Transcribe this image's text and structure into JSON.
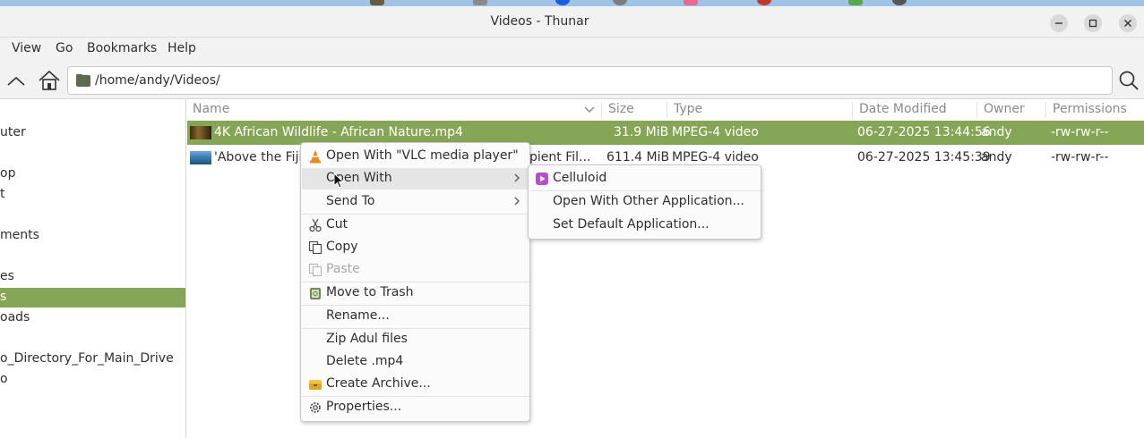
{
  "window": {
    "title": "Videos - Thunar"
  },
  "menubar": {
    "items": [
      "View",
      "Go",
      "Bookmarks",
      "Help"
    ]
  },
  "toolbar": {
    "path": "/home/andy/Videos/"
  },
  "sidebar": {
    "items": [
      {
        "label": "uter",
        "selected": false
      },
      {
        "label": "op",
        "selected": false
      },
      {
        "label": "t",
        "selected": false
      },
      {
        "label": "ments",
        "selected": false
      },
      {
        "label": "es",
        "selected": false
      },
      {
        "label": "s",
        "selected": true
      },
      {
        "label": "oads",
        "selected": false
      },
      {
        "label": "o_Directory_For_Main_Drive",
        "selected": false
      },
      {
        "label": "o",
        "selected": false
      }
    ]
  },
  "columns": {
    "name": "Name",
    "size": "Size",
    "type": "Type",
    "date": "Date Modified",
    "owner": "Owner",
    "permissions": "Permissions"
  },
  "files": [
    {
      "name": "4K African Wildlife - African Nature.mp4",
      "size": "31.9 MiB",
      "type": "MPEG-4 video",
      "date": "06-27-2025 13:44:56",
      "owner": "andy",
      "permissions": "-rw-rw-r--",
      "selected": true
    },
    {
      "name": "'Above the Fiji",
      "name_tail": "pient Fil...",
      "size": "611.4 MiB",
      "type": "MPEG-4 video",
      "date": "06-27-2025 13:45:39",
      "owner": "andy",
      "permissions": "-rw-rw-r--",
      "selected": false
    }
  ],
  "context_menu": {
    "items": [
      {
        "label": "Open With \"VLC media player\"",
        "icon": "vlc-icon"
      },
      {
        "label": "Open With",
        "icon": "",
        "submenu": true,
        "hover": true
      },
      {
        "label": "Send To",
        "icon": "",
        "submenu": true
      },
      {
        "label": "Cut",
        "icon": "scissors-icon"
      },
      {
        "label": "Copy",
        "icon": "copy-icon"
      },
      {
        "label": "Paste",
        "icon": "paste-icon",
        "disabled": true
      },
      {
        "label": "Move to Trash",
        "icon": "trash-icon"
      },
      {
        "label": "Rename...",
        "icon": ""
      },
      {
        "label": "Zip Adul files",
        "icon": ""
      },
      {
        "label": "Delete .mp4",
        "icon": ""
      },
      {
        "label": "Create Archive...",
        "icon": "archive-icon"
      },
      {
        "label": "Properties...",
        "icon": "gear-icon"
      }
    ]
  },
  "open_with_submenu": {
    "items": [
      {
        "label": "Celluloid",
        "icon": "celluloid-icon"
      },
      {
        "label": "Open With Other Application...",
        "icon": ""
      },
      {
        "label": "Set Default Application...",
        "icon": ""
      }
    ]
  },
  "colors": {
    "selection": "#87a556",
    "celluloid": "#b44fc8",
    "vlc": "#f08a1c"
  }
}
